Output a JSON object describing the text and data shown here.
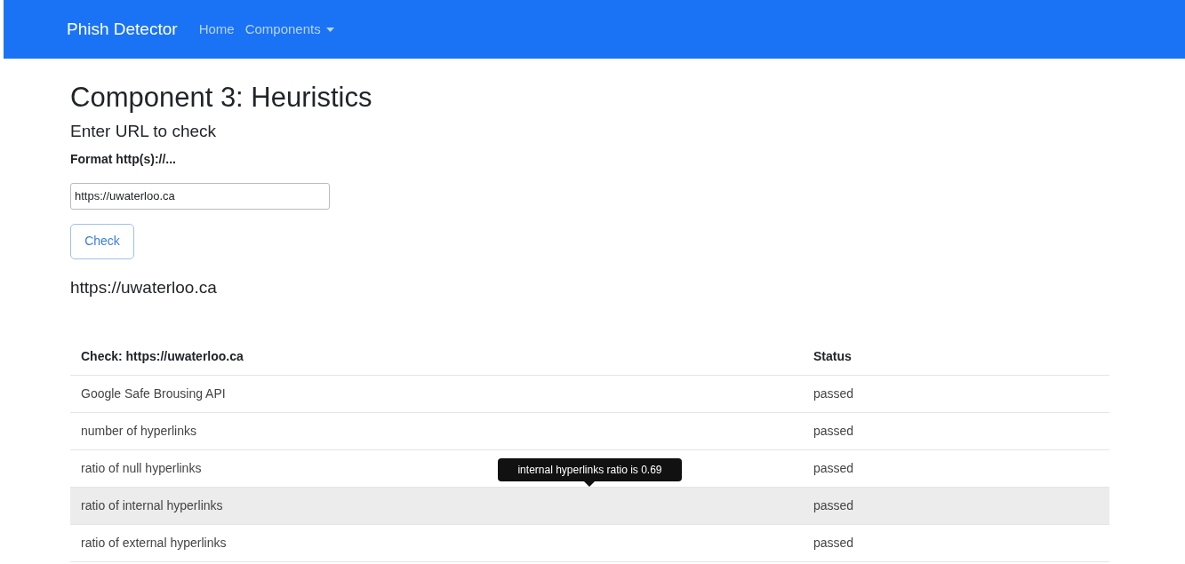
{
  "navbar": {
    "brand": "Phish Detector",
    "links": [
      {
        "label": "Home",
        "kind": "link"
      },
      {
        "label": "Components",
        "kind": "dropdown"
      }
    ]
  },
  "title": "Component 3: Heuristics",
  "subtitle": "Enter URL to check",
  "format_label": "Format http(s)://...",
  "url_field": {
    "value": "https://uwaterloo.ca"
  },
  "check_button": "Check",
  "result_url": "https://uwaterloo.ca",
  "table": {
    "columns": [
      "Check: https://uwaterloo.ca",
      "Status"
    ],
    "rows": [
      {
        "check": "Google Safe Brousing API",
        "status": "passed",
        "highlighted": false
      },
      {
        "check": "number of hyperlinks",
        "status": "passed",
        "highlighted": false
      },
      {
        "check": "ratio of null hyperlinks",
        "status": "passed",
        "highlighted": false
      },
      {
        "check": "ratio of internal hyperlinks",
        "status": "passed",
        "highlighted": true,
        "tooltip": "internal hyperlinks ratio is 0.69"
      },
      {
        "check": "ratio of external hyperlinks",
        "status": "passed",
        "highlighted": false
      }
    ]
  }
}
